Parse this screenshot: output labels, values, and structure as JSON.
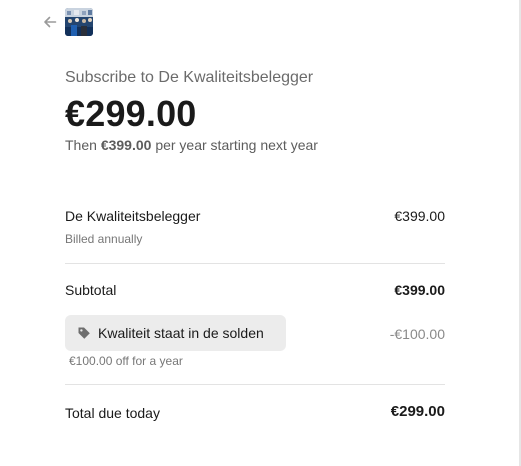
{
  "header": {
    "back_icon": "arrow-left-icon",
    "logo": "merchant-logo"
  },
  "summary": {
    "subscribe_title": "Subscribe to De Kwaliteitsbelegger",
    "price": "€299.00",
    "then_prefix": "Then",
    "then_amount": "€399.00",
    "then_suffix": "per year starting next year"
  },
  "line_item": {
    "name": "De Kwaliteitsbelegger",
    "billing": "Billed annually",
    "amount": "€399.00"
  },
  "subtotal": {
    "label": "Subtotal",
    "amount": "€399.00"
  },
  "promotion": {
    "icon": "tag-icon",
    "code_label": "Kwaliteit staat in de solden",
    "description": "€100.00 off for a year",
    "amount": "-€100.00"
  },
  "total": {
    "label": "Total due today",
    "amount": "€299.00"
  },
  "colors": {
    "text": "#1a1a1a",
    "muted": "#6b6b6b",
    "promo_bg": "#ececec",
    "divider": "#e3e3e3"
  }
}
